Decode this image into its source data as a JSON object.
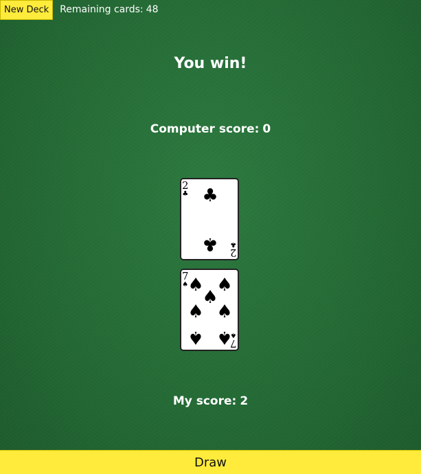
{
  "toolbar": {
    "new_deck_label": "New Deck",
    "remaining_label": "Remaining cards:",
    "remaining_count": "48"
  },
  "result": {
    "message": "You win!"
  },
  "computer": {
    "score_label": "Computer score:",
    "score": "0",
    "card": {
      "rank": "2",
      "suit": "♣",
      "suit_name": "club-icon"
    }
  },
  "player": {
    "score_label": "My score:",
    "score": "2",
    "card": {
      "rank": "7",
      "suit": "♠",
      "suit_name": "spade-icon"
    }
  },
  "actions": {
    "draw_label": "Draw"
  },
  "colors": {
    "felt": "#246a35",
    "button": "#ffeb3b",
    "text": "#ffffff"
  }
}
